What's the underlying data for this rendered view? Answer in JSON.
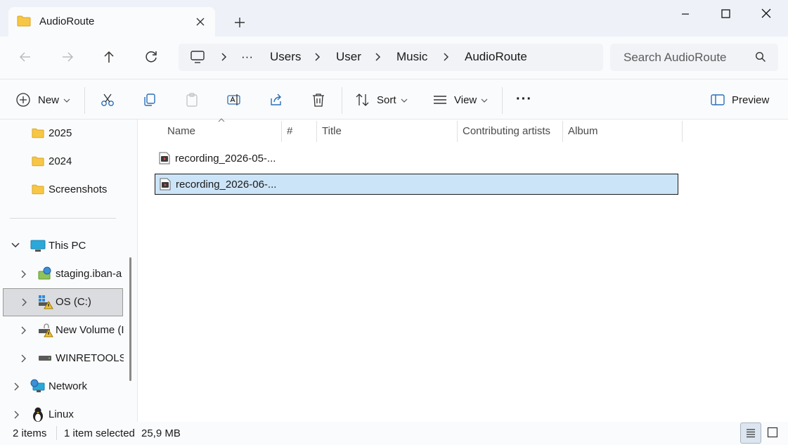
{
  "window": {
    "tab_title": "AudioRoute"
  },
  "address": {
    "more": "···",
    "crumbs": [
      "Users",
      "User",
      "Music",
      "AudioRoute"
    ]
  },
  "search": {
    "placeholder": "Search AudioRoute"
  },
  "commands": {
    "new_label": "New",
    "sort_label": "Sort",
    "view_label": "View",
    "more_label": "···",
    "preview_label": "Preview"
  },
  "sidebar": {
    "items": [
      {
        "label": "2025"
      },
      {
        "label": "2024"
      },
      {
        "label": "Screenshots"
      },
      {
        "label": "This PC"
      },
      {
        "label": "staging.iban-a"
      },
      {
        "label": "OS (C:)"
      },
      {
        "label": "New Volume (I"
      },
      {
        "label": "WINRETOOLS ("
      },
      {
        "label": "Network"
      },
      {
        "label": "Linux"
      }
    ]
  },
  "columns": [
    "Name",
    "#",
    "Title",
    "Contributing artists",
    "Album"
  ],
  "files": [
    {
      "name": "recording_2026-05-..."
    },
    {
      "name": "recording_2026-06-..."
    }
  ],
  "status": {
    "item_count": "2 items",
    "selection": "1 item selected",
    "size": "25,9 MB"
  },
  "colors": {
    "accent": "#0067c0",
    "selection_bg": "#cce4f7",
    "folder": "#f7c644"
  }
}
